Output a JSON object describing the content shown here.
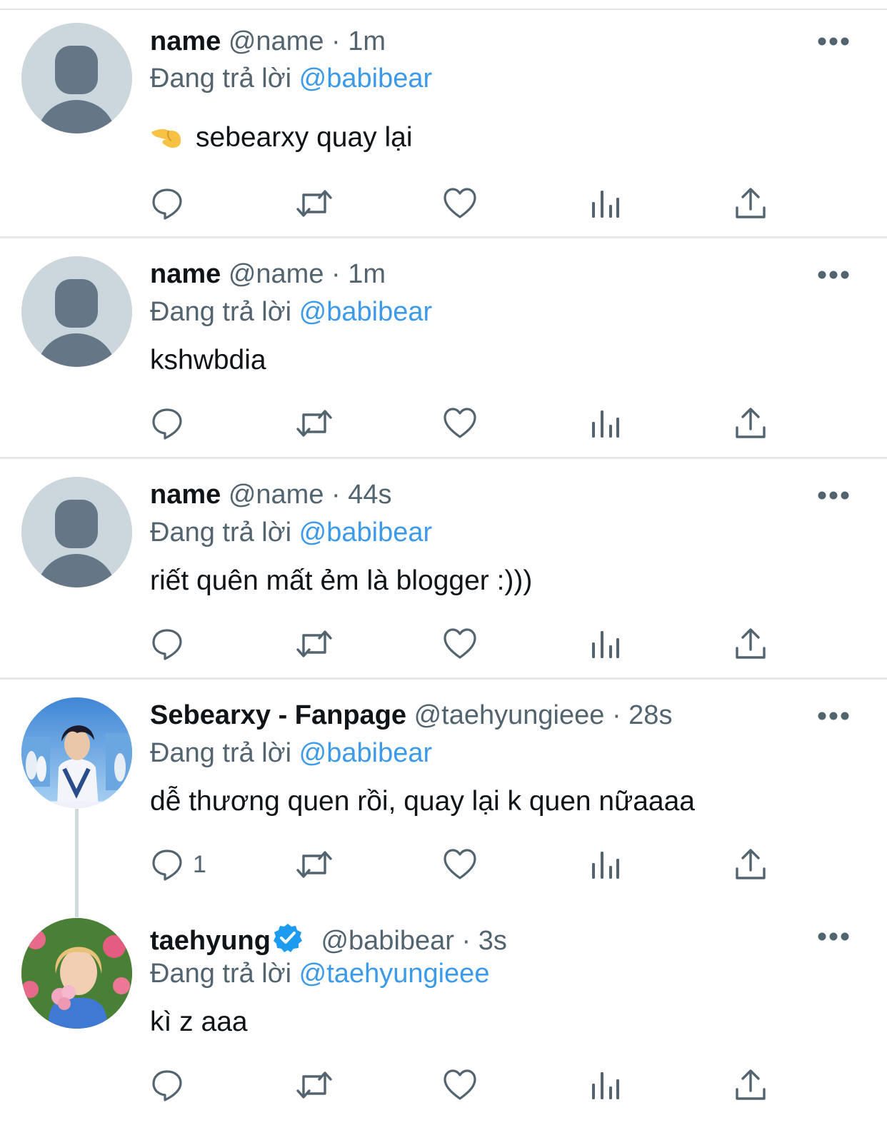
{
  "tweets": [
    {
      "display_name": "name",
      "handle": "@name",
      "separator": "·",
      "time": "1m",
      "reply_prefix": "Đang trả lời",
      "reply_to": "@babibear",
      "text": "sebearxy quay lại",
      "text_emoji": "backhand-index-pointing-left-icon",
      "avatar": "default-avatar",
      "reply_count": ""
    },
    {
      "display_name": "name",
      "handle": "@name",
      "separator": "·",
      "time": "1m",
      "reply_prefix": "Đang trả lời",
      "reply_to": "@babibear",
      "text": "kshwbdia",
      "avatar": "default-avatar",
      "reply_count": ""
    },
    {
      "display_name": "name",
      "handle": "@name",
      "separator": "·",
      "time": "44s",
      "reply_prefix": "Đang trả lời",
      "reply_to": "@babibear",
      "text": "riết quên mất ẻm là blogger :)))",
      "avatar": "default-avatar",
      "reply_count": ""
    },
    {
      "display_name": "Sebearxy - Fanpage",
      "handle": "@taehyungieee",
      "separator": "·",
      "time": "28s",
      "reply_prefix": "Đang trả lời",
      "reply_to": "@babibear",
      "text": "dễ thương quen rồi, quay lại k quen nữaaaa",
      "avatar": "photo-avatar-stage",
      "reply_count": "1"
    },
    {
      "display_name": "taehyung",
      "verified": true,
      "handle": "@babibear",
      "separator": "·",
      "time": "3s",
      "reply_prefix": "Đang trả lời",
      "reply_to": "@taehyungieee",
      "text": "kì z aaa",
      "avatar": "photo-avatar-flowers",
      "reply_count": ""
    }
  ],
  "colors": {
    "link": "#3d9ae8",
    "secondary_text": "#536471",
    "primary_text": "#0f1419",
    "icon": "#536471",
    "verified": "#1d9bf0",
    "avatar_placeholder_bg": "#ccd6dd",
    "avatar_placeholder_fg": "#657786"
  }
}
